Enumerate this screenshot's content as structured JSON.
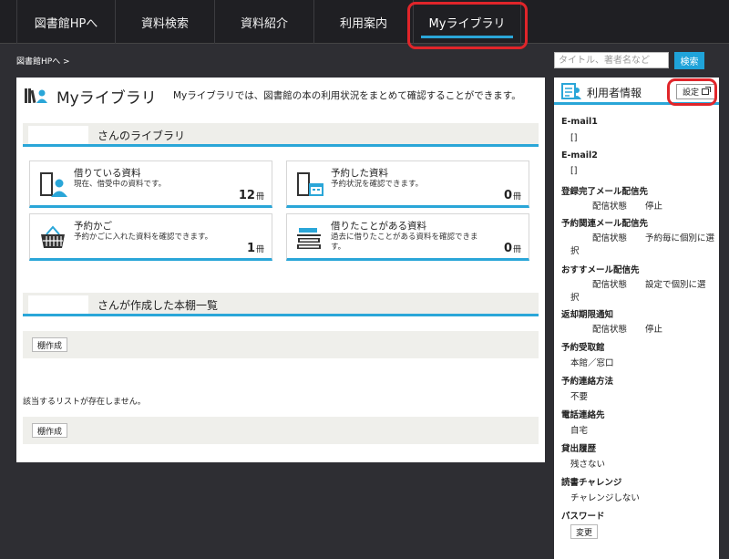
{
  "nav": {
    "items": [
      {
        "label": "図書館HPへ"
      },
      {
        "label": "資料検索"
      },
      {
        "label": "資料紹介"
      },
      {
        "label": "利用案内"
      },
      {
        "label": "Myライブラリ"
      }
    ]
  },
  "breadcrumb": "図書館HPへ >",
  "search": {
    "placeholder": "タイトル、著者名など",
    "button_label": "検索"
  },
  "main": {
    "title": "Myライブラリ",
    "description": "Myライブラリでは、図書館の本の利用状況をまとめて確認することができます。",
    "library_section_label": "さんのライブラリ",
    "cards": [
      {
        "title": "借りている資料",
        "desc": "現在、借受中の資料です。",
        "count": "12",
        "unit": "冊"
      },
      {
        "title": "予約した資料",
        "desc": "予約状況を確認できます。",
        "count": "0",
        "unit": "冊"
      },
      {
        "title": "予約かご",
        "desc": "予約かごに入れた資料を確認できます。",
        "count": "1",
        "unit": "冊"
      },
      {
        "title": "借りたことがある資料",
        "desc": "過去に借りたことがある資料を確認できます。",
        "count": "0",
        "unit": "冊"
      }
    ],
    "shelf_section_label": "さんが作成した本棚一覧",
    "create_shelf_label": "棚作成",
    "empty_message": "該当するリストが存在しません。"
  },
  "sidebar": {
    "title": "利用者情報",
    "settings_label": "設定",
    "email1_label": "E-mail1",
    "email1_value": "[]",
    "email2_label": "E-mail2",
    "email2_value": "[]",
    "notif1_label": "登録完了メール配信先",
    "notif1_key": "配信状態",
    "notif1_val": "停止",
    "notif2_label": "予約関連メール配信先",
    "notif2_key": "配信状態",
    "notif2_val": "予約毎に個別に選",
    "notif2_wrap": "択",
    "notif3_label": "おすすメール配信先",
    "notif3_key": "配信状態",
    "notif3_val": "設定で個別に選",
    "notif3_wrap": "択",
    "notif4_label": "返却期限通知",
    "notif4_key": "配信状態",
    "notif4_val": "停止",
    "pickup_label": "予約受取館",
    "pickup_value": "本館／窓口",
    "contact_label": "予約連絡方法",
    "contact_value": "不要",
    "phone_label": "電話連絡先",
    "phone_value": "自宅",
    "history_label": "貸出履歴",
    "history_value": "残さない",
    "challenge_label": "読書チャレンジ",
    "challenge_value": "チャレンジしない",
    "password_label": "パスワード",
    "password_button": "変更"
  },
  "colors": {
    "accent": "#2aa6d8",
    "highlight": "#e0252a",
    "nav_bg": "#1f1f23",
    "page_bg": "#2e2e33"
  }
}
